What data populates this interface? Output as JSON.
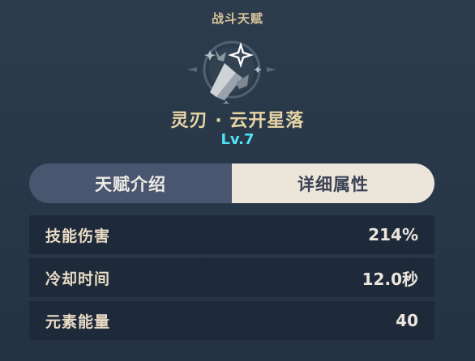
{
  "header": {
    "section_title": "战斗天赋"
  },
  "skill": {
    "icon": "star-blade-emblem-icon",
    "name": "灵刃 · 云开星落",
    "level": "Lv.7"
  },
  "tabs": [
    {
      "label": "天赋介绍",
      "active": false
    },
    {
      "label": "详细属性",
      "active": true
    }
  ],
  "stats": [
    {
      "label": "技能伤害",
      "value": "214%"
    },
    {
      "label": "冷却时间",
      "value": "12.0秒"
    },
    {
      "label": "元素能量",
      "value": "40"
    }
  ],
  "colors": {
    "title_gold": "#d9c49b",
    "level_cyan": "#4fe3f5",
    "tab_inactive": "#4a5670",
    "tab_active": "#ece5da",
    "row_bg": "#1e2a3a"
  }
}
